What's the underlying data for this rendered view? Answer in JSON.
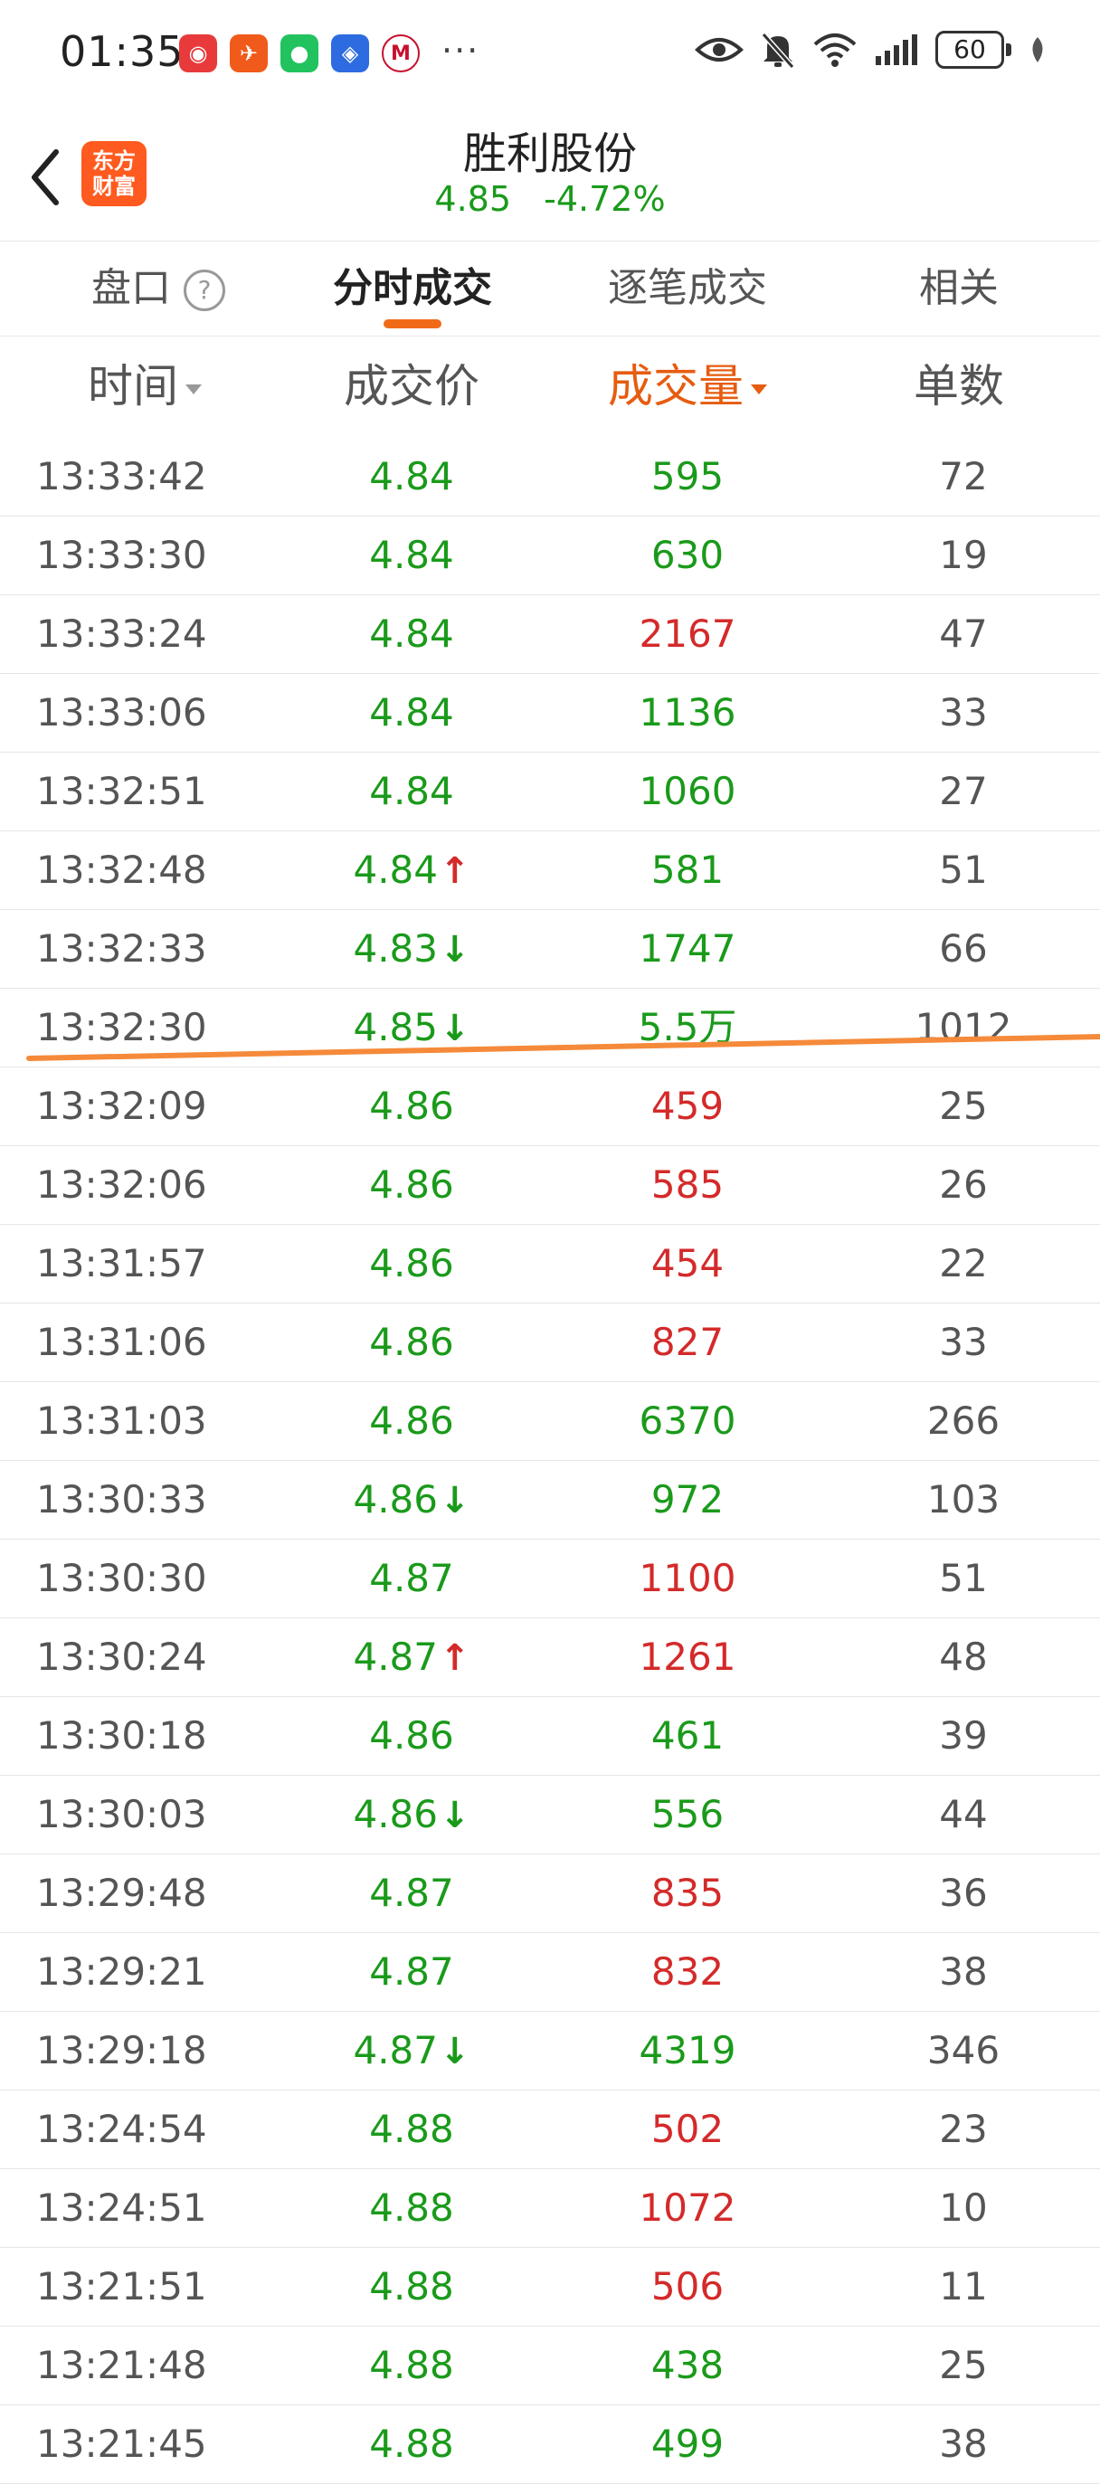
{
  "status_bar": {
    "time": "01:35",
    "dots": "···",
    "battery": "60"
  },
  "header": {
    "logo_line1": "东方",
    "logo_line2": "财富",
    "stock_name": "胜利股份",
    "price": "4.85",
    "change_pct": "-4.72%"
  },
  "tabs": {
    "items": [
      "盘口",
      "分时成交",
      "逐笔成交",
      "相关"
    ],
    "help": "?",
    "active": "分时成交"
  },
  "columns": {
    "time": "时间",
    "price": "成交价",
    "volume": "成交量",
    "count": "单数"
  },
  "colors": {
    "up": "#d42a2a",
    "down": "#1a9a1a",
    "accent": "#f06a18"
  },
  "trades": [
    {
      "time": "13:33:42",
      "price": "4.84",
      "arrow": "",
      "volume": "595",
      "vol_color": "green",
      "count": "72"
    },
    {
      "time": "13:33:30",
      "price": "4.84",
      "arrow": "",
      "volume": "630",
      "vol_color": "green",
      "count": "19"
    },
    {
      "time": "13:33:24",
      "price": "4.84",
      "arrow": "",
      "volume": "2167",
      "vol_color": "red",
      "count": "47"
    },
    {
      "time": "13:33:06",
      "price": "4.84",
      "arrow": "",
      "volume": "1136",
      "vol_color": "green",
      "count": "33"
    },
    {
      "time": "13:32:51",
      "price": "4.84",
      "arrow": "",
      "volume": "1060",
      "vol_color": "green",
      "count": "27"
    },
    {
      "time": "13:32:48",
      "price": "4.84",
      "arrow": "up",
      "volume": "581",
      "vol_color": "green",
      "count": "51"
    },
    {
      "time": "13:32:33",
      "price": "4.83",
      "arrow": "down",
      "volume": "1747",
      "vol_color": "green",
      "count": "66"
    },
    {
      "time": "13:32:30",
      "price": "4.85",
      "arrow": "down",
      "volume": "5.5万",
      "vol_color": "green",
      "count": "1012"
    },
    {
      "time": "13:32:09",
      "price": "4.86",
      "arrow": "",
      "volume": "459",
      "vol_color": "red",
      "count": "25"
    },
    {
      "time": "13:32:06",
      "price": "4.86",
      "arrow": "",
      "volume": "585",
      "vol_color": "red",
      "count": "26"
    },
    {
      "time": "13:31:57",
      "price": "4.86",
      "arrow": "",
      "volume": "454",
      "vol_color": "red",
      "count": "22"
    },
    {
      "time": "13:31:06",
      "price": "4.86",
      "arrow": "",
      "volume": "827",
      "vol_color": "red",
      "count": "33"
    },
    {
      "time": "13:31:03",
      "price": "4.86",
      "arrow": "",
      "volume": "6370",
      "vol_color": "green",
      "count": "266"
    },
    {
      "time": "13:30:33",
      "price": "4.86",
      "arrow": "down",
      "volume": "972",
      "vol_color": "green",
      "count": "103"
    },
    {
      "time": "13:30:30",
      "price": "4.87",
      "arrow": "",
      "volume": "1100",
      "vol_color": "red",
      "count": "51"
    },
    {
      "time": "13:30:24",
      "price": "4.87",
      "arrow": "up",
      "volume": "1261",
      "vol_color": "red",
      "count": "48"
    },
    {
      "time": "13:30:18",
      "price": "4.86",
      "arrow": "",
      "volume": "461",
      "vol_color": "green",
      "count": "39"
    },
    {
      "time": "13:30:03",
      "price": "4.86",
      "arrow": "down",
      "volume": "556",
      "vol_color": "green",
      "count": "44"
    },
    {
      "time": "13:29:48",
      "price": "4.87",
      "arrow": "",
      "volume": "835",
      "vol_color": "red",
      "count": "36"
    },
    {
      "time": "13:29:21",
      "price": "4.87",
      "arrow": "",
      "volume": "832",
      "vol_color": "red",
      "count": "38"
    },
    {
      "time": "13:29:18",
      "price": "4.87",
      "arrow": "down",
      "volume": "4319",
      "vol_color": "green",
      "count": "346"
    },
    {
      "time": "13:24:54",
      "price": "4.88",
      "arrow": "",
      "volume": "502",
      "vol_color": "red",
      "count": "23"
    },
    {
      "time": "13:24:51",
      "price": "4.88",
      "arrow": "",
      "volume": "1072",
      "vol_color": "red",
      "count": "10"
    },
    {
      "time": "13:21:51",
      "price": "4.88",
      "arrow": "",
      "volume": "506",
      "vol_color": "red",
      "count": "11"
    },
    {
      "time": "13:21:48",
      "price": "4.88",
      "arrow": "",
      "volume": "438",
      "vol_color": "green",
      "count": "25"
    },
    {
      "time": "13:21:45",
      "price": "4.88",
      "arrow": "",
      "volume": "499",
      "vol_color": "green",
      "count": "38"
    }
  ]
}
